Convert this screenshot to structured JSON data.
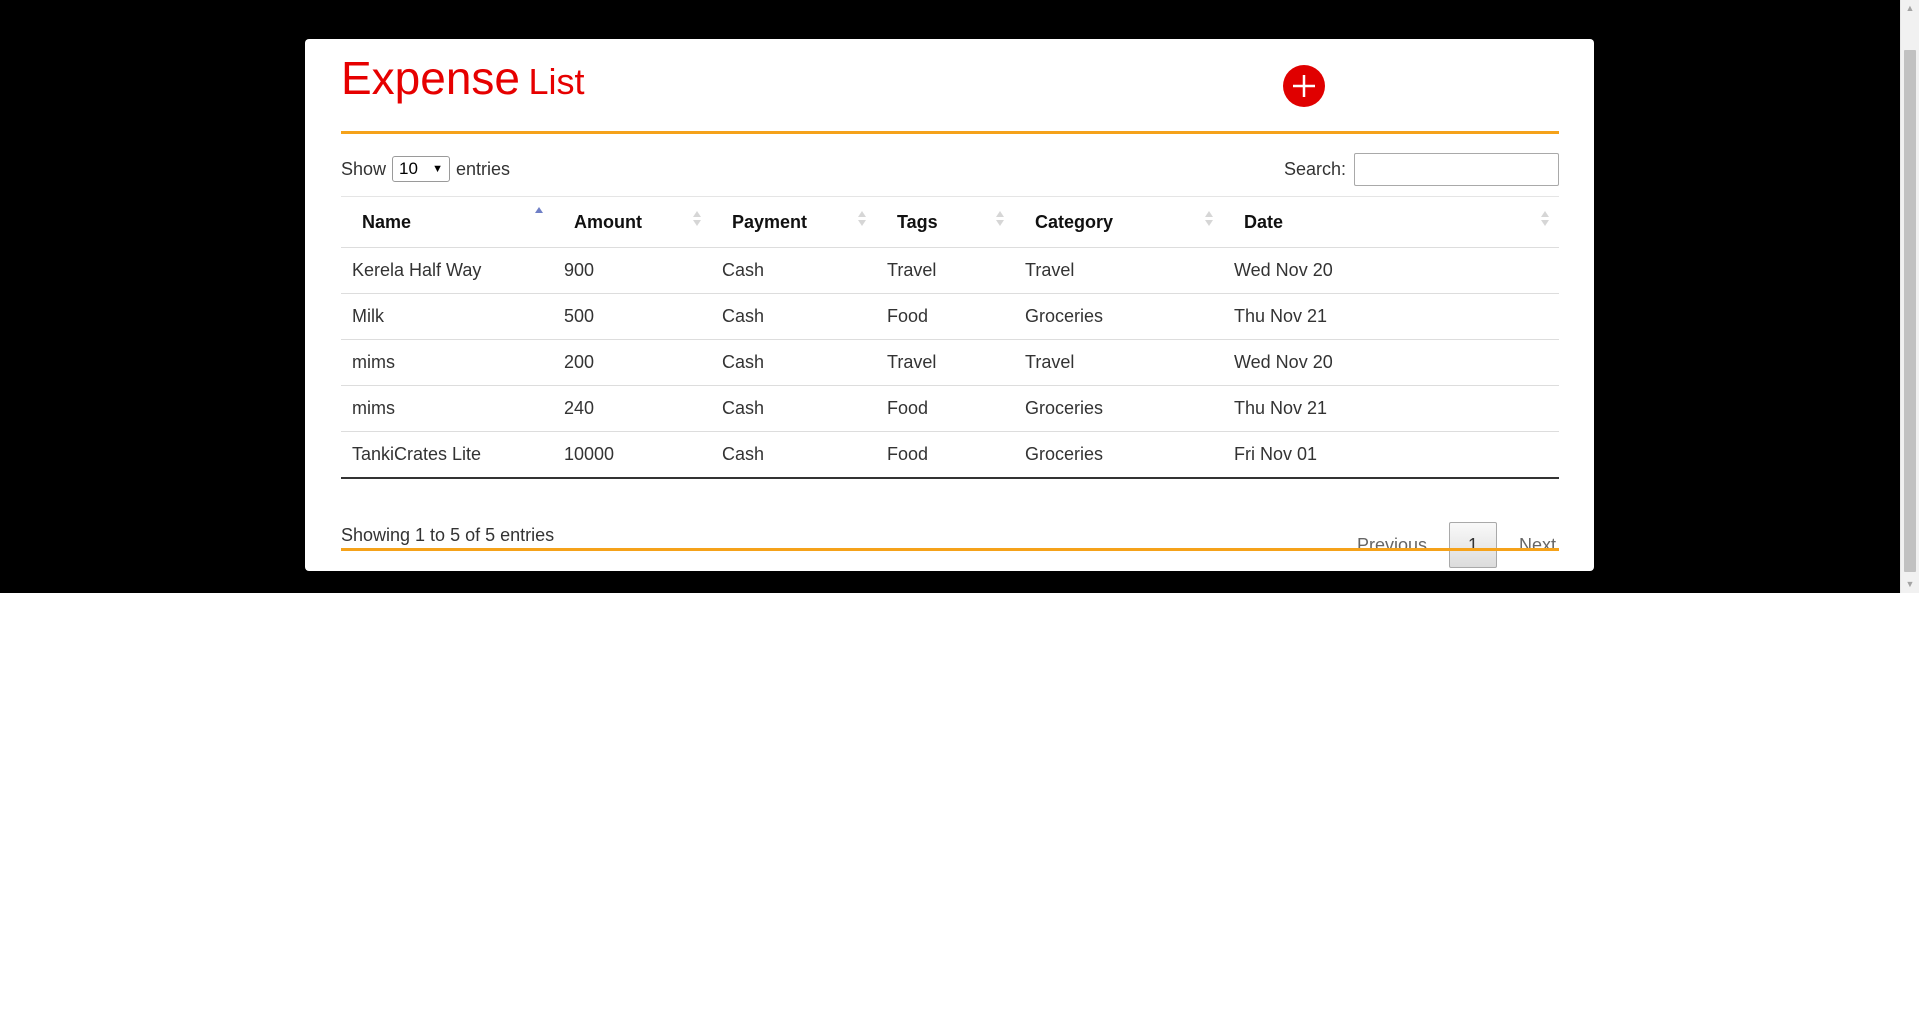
{
  "title": {
    "main": "Expense",
    "sub": "List"
  },
  "add_button": {
    "icon": "plus-icon"
  },
  "length_control": {
    "prefix": "Show",
    "value": "10",
    "suffix": "entries"
  },
  "search": {
    "label": "Search:",
    "value": ""
  },
  "table": {
    "headers": [
      "Name",
      "Amount",
      "Payment",
      "Tags",
      "Category",
      "Date"
    ],
    "sorted_column": "Name",
    "rows": [
      [
        "Kerela Half Way",
        "900",
        "Cash",
        "Travel",
        "Travel",
        "Wed Nov 20"
      ],
      [
        "Milk",
        "500",
        "Cash",
        "Food",
        "Groceries",
        "Thu Nov 21"
      ],
      [
        "mims",
        "200",
        "Cash",
        "Travel",
        "Travel",
        "Wed Nov 20"
      ],
      [
        "mims",
        "240",
        "Cash",
        "Food",
        "Groceries",
        "Thu Nov 21"
      ],
      [
        "TankiCrates Lite",
        "10000",
        "Cash",
        "Food",
        "Groceries",
        "Fri Nov 01"
      ]
    ]
  },
  "info": "Showing 1 to 5 of 5 entries",
  "pagination": {
    "previous": "Previous",
    "current": "1",
    "next": "Next"
  },
  "colors": {
    "title": "#e60000",
    "accent_rule": "#f5a21a",
    "add_button": "#e00000",
    "background_band": "#000000"
  }
}
